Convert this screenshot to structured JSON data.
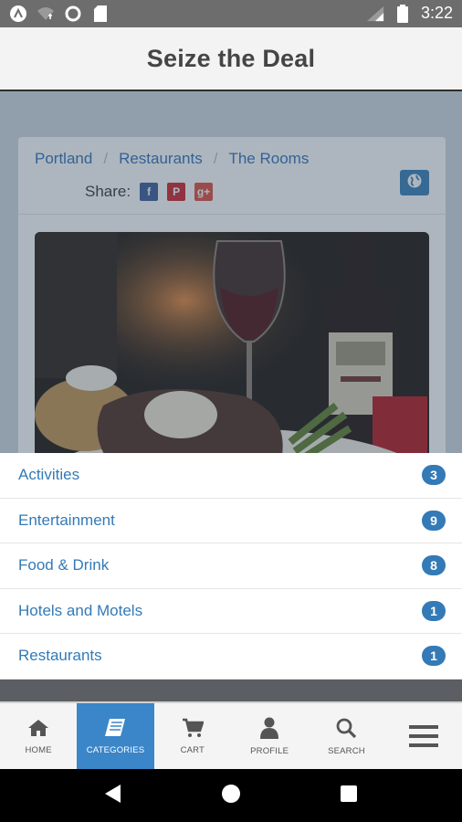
{
  "status_bar": {
    "time": "3:22",
    "icons": [
      "app-icon",
      "wifi-icon",
      "circle-icon",
      "sd-card-icon",
      "signal-icon",
      "battery-icon"
    ]
  },
  "header": {
    "title": "Seize the Deal"
  },
  "card": {
    "breadcrumb": [
      "Portland",
      "Restaurants",
      "The Rooms"
    ],
    "breadcrumb_separator": "/",
    "share_label": "Share:",
    "share_buttons": [
      {
        "icon": "facebook-icon",
        "glyph": "f"
      },
      {
        "icon": "pinterest-icon",
        "glyph": "P"
      },
      {
        "icon": "google-plus-icon",
        "glyph": "g+"
      }
    ],
    "globe_icon": "globe-icon",
    "photo_alt": "steak-dinner-photo"
  },
  "categories": [
    {
      "label": "Activities",
      "count": "3"
    },
    {
      "label": "Entertainment",
      "count": "9"
    },
    {
      "label": "Food & Drink",
      "count": "8"
    },
    {
      "label": "Hotels and Motels",
      "count": "1"
    },
    {
      "label": "Restaurants",
      "count": "1"
    }
  ],
  "bottom_nav": {
    "items": [
      {
        "label": "HOME",
        "icon": "home-icon"
      },
      {
        "label": "CATEGORIES",
        "icon": "book-icon",
        "active": true
      },
      {
        "label": "CART",
        "icon": "cart-icon"
      },
      {
        "label": "PROFILE",
        "icon": "user-icon"
      },
      {
        "label": "SEARCH",
        "icon": "search-icon"
      },
      {
        "label": "",
        "icon": "menu-icon"
      }
    ]
  },
  "colors": {
    "accent": "#337ab7",
    "active_nav": "#3a86c8",
    "header_bg": "#f3f3f3"
  }
}
